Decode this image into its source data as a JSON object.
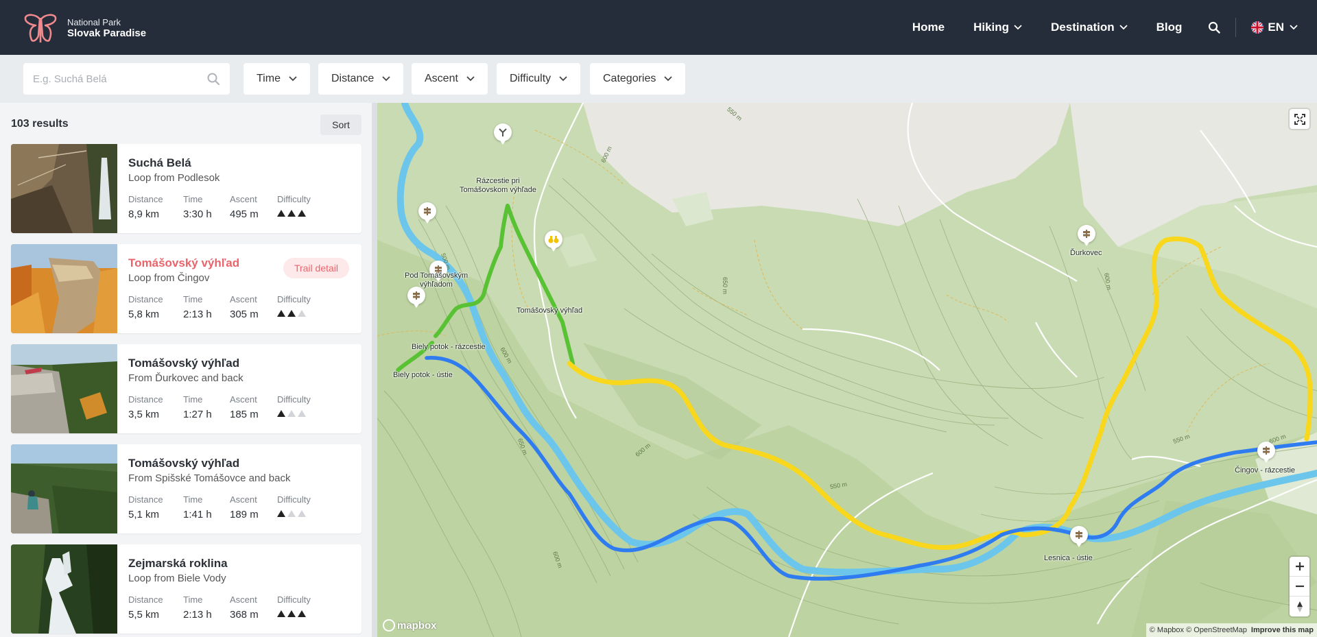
{
  "header": {
    "logo_line1": "National Park",
    "logo_line2": "Slovak Paradise",
    "nav": {
      "home": "Home",
      "hiking": "Hiking",
      "destination": "Destination",
      "blog": "Blog"
    },
    "language": "EN",
    "icons": [
      "butterfly-logo-icon",
      "search-icon",
      "uk-flag-icon",
      "chevron-down-icon"
    ]
  },
  "filters": {
    "search_placeholder": "E.g. Suchá Belá",
    "time": "Time",
    "distance": "Distance",
    "ascent": "Ascent",
    "difficulty": "Difficulty",
    "categories": "Categories"
  },
  "results": {
    "count": "103 results",
    "sort_label": "Sort",
    "stat_labels": {
      "distance": "Distance",
      "time": "Time",
      "ascent": "Ascent",
      "difficulty": "Difficulty"
    },
    "trail_detail_label": "Trail detail",
    "items": [
      {
        "title": "Suchá Belá",
        "subtitle": "Loop from Podlesok",
        "distance": "8,9 km",
        "time": "3:30 h",
        "ascent": "495 m",
        "difficulty": 3
      },
      {
        "title": "Tomášovský výhľad",
        "subtitle": "Loop from Čingov",
        "distance": "5,8 km",
        "time": "2:13 h",
        "ascent": "305 m",
        "difficulty": 2
      },
      {
        "title": "Tomášovský výhľad",
        "subtitle": "From Ďurkovec and back",
        "distance": "3,5 km",
        "time": "1:27 h",
        "ascent": "185 m",
        "difficulty": 1
      },
      {
        "title": "Tomášovský výhľad",
        "subtitle": "From Spišské Tomášovce and back",
        "distance": "5,1 km",
        "time": "1:41 h",
        "ascent": "189 m",
        "difficulty": 1
      },
      {
        "title": "Zejmarská roklina",
        "subtitle": "Loop from Biele Vody",
        "distance": "5,5 km",
        "time": "2:13 h",
        "ascent": "368 m",
        "difficulty": 3
      }
    ]
  },
  "map": {
    "labels": {
      "razcestie": "Rázcestie pri\nTomášovskom výhľade",
      "pod_tomasovskym": "Pod Tomášovským\nvýhľadom",
      "tomasovsky": "Tomášovský výhľad",
      "biely_razcestie": "Biely potok - rázcestie",
      "biely_ustie": "Biely potok - ústie",
      "durkovec": "Ďurkovec",
      "cingov": "Čingov - rázcestie",
      "lesnica": "Lesnica - ústie"
    },
    "contours": [
      "600 m",
      "550 m",
      "500 m",
      "600 m",
      "650 m",
      "600 m",
      "550 m",
      "600 m",
      "650 m",
      "600 m",
      "550 m",
      "600 m"
    ],
    "attribution": "© Mapbox © OpenStreetMap",
    "improve": "Improve this map",
    "brand": "mapbox",
    "colors": {
      "yellow_route": "#f9d71c",
      "blue_route": "#2f7cf0",
      "green_route": "#59c234",
      "river": "#6cc6ec",
      "terrain": "#c9d9b3"
    }
  }
}
